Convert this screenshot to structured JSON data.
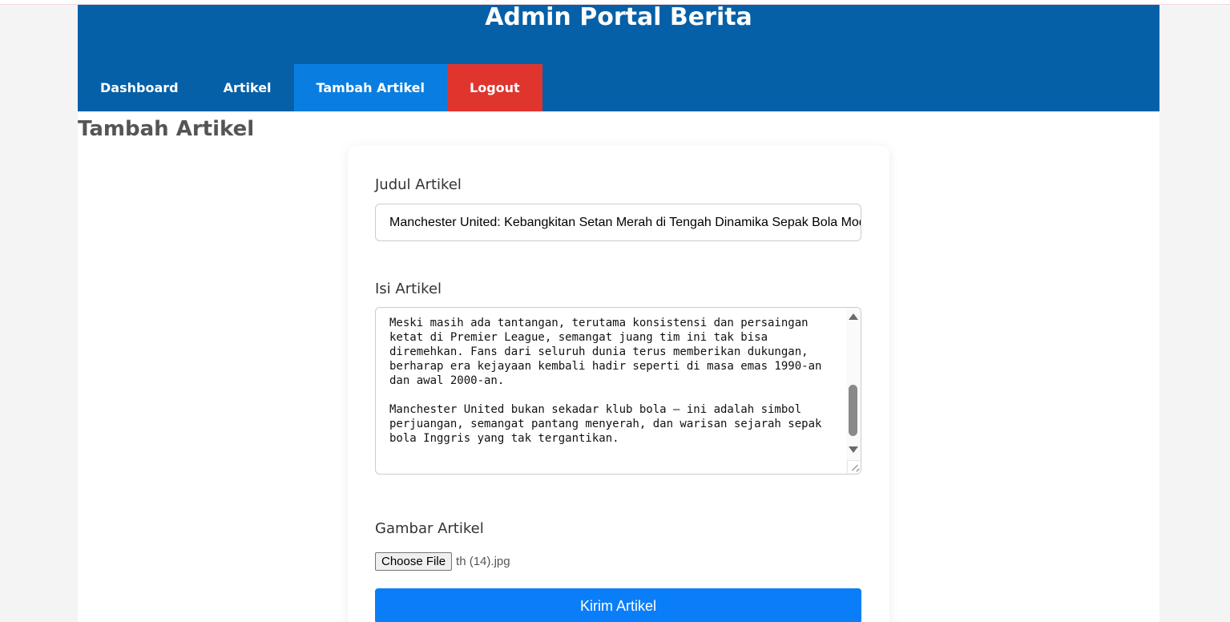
{
  "header": {
    "title": "Admin Portal Berita",
    "nav": [
      {
        "label": "Dashboard"
      },
      {
        "label": "Artikel"
      },
      {
        "label": "Tambah Artikel"
      },
      {
        "label": "Logout"
      }
    ]
  },
  "page": {
    "title": "Tambah Artikel"
  },
  "form": {
    "title_label": "Judul Artikel",
    "title_value": "Manchester United: Kebangkitan Setan Merah di Tengah Dinamika Sepak Bola Modern",
    "content_label": "Isi Artikel",
    "content_value": "Meski masih ada tantangan, terutama konsistensi dan persaingan ketat di Premier League, semangat juang tim ini tak bisa diremehkan. Fans dari seluruh dunia terus memberikan dukungan, berharap era kejayaan kembali hadir seperti di masa emas 1990-an dan awal 2000-an.\n\nManchester United bukan sekadar klub bola — ini adalah simbol perjuangan, semangat pantang menyerah, dan warisan sejarah sepak bola Inggris yang tak tergantikan.",
    "image_label": "Gambar Artikel",
    "file_button_label": "Choose File",
    "file_name": "th (14).jpg",
    "submit_label": "Kirim Artikel"
  },
  "colors": {
    "header_bg": "#0560a8",
    "nav_active": "#0a7ee0",
    "logout_bg": "#e0352f",
    "submit_bg": "#0a7ef8"
  }
}
